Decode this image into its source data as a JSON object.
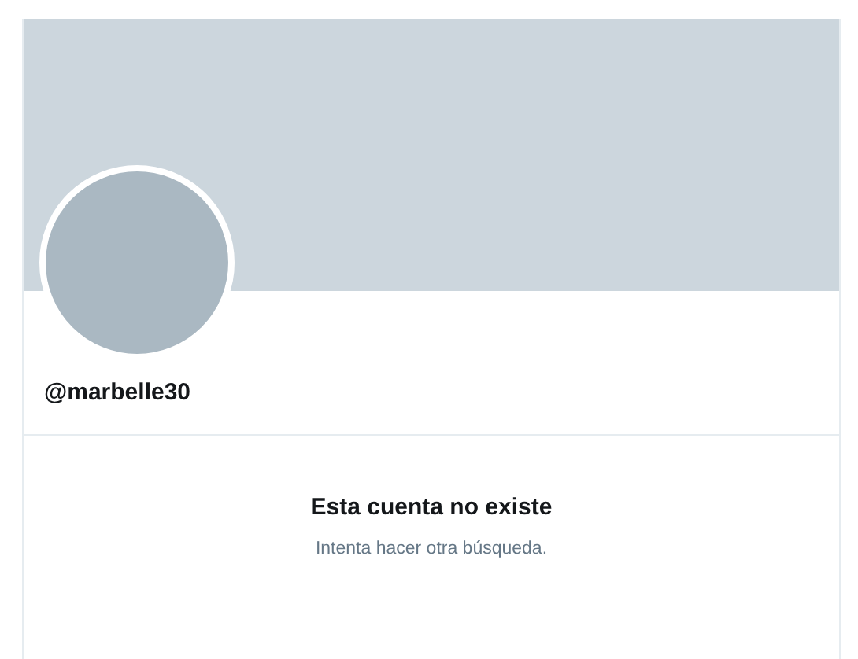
{
  "profile": {
    "handle": "@marbelle30"
  },
  "message": {
    "title": "Esta cuenta no existe",
    "subtitle": "Intenta hacer otra búsqueda."
  }
}
